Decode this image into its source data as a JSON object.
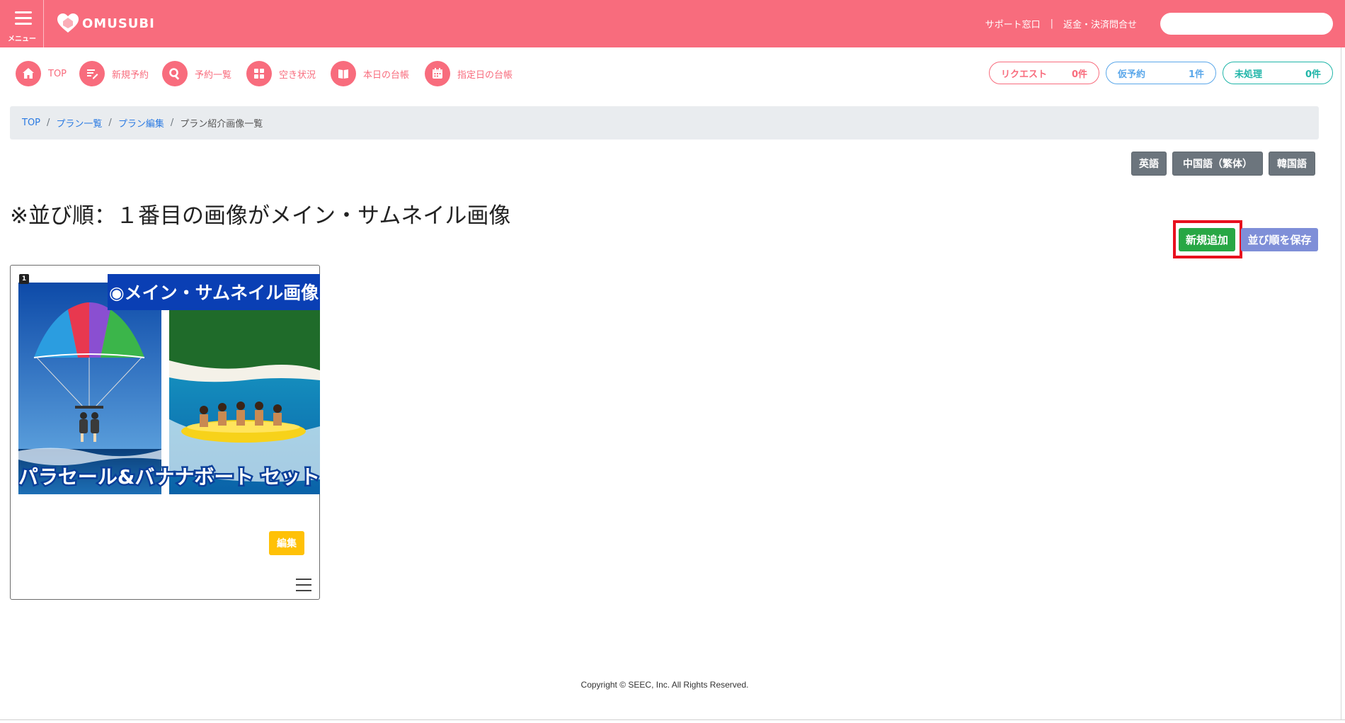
{
  "header": {
    "menu_label": "メニュー",
    "logo_text": "OMUSUBI",
    "links": [
      "サポート窓口",
      "返金・決済問合せ"
    ],
    "link_separator": "|",
    "search_placeholder": ""
  },
  "nav": {
    "items": [
      {
        "label": "TOP",
        "icon": "home-icon"
      },
      {
        "label": "新規予約",
        "icon": "edit-icon"
      },
      {
        "label": "予約一覧",
        "icon": "search-icon"
      },
      {
        "label": "空き状況",
        "icon": "grid-icon"
      },
      {
        "label": "本日の台帳",
        "icon": "book-icon"
      },
      {
        "label": "指定日の台帳",
        "icon": "calendar-icon"
      }
    ],
    "status_pills": [
      {
        "label": "リクエスト",
        "value": "0件",
        "color": "#f86c7d"
      },
      {
        "label": "仮予約",
        "value": "1件",
        "color": "#5aa7ea"
      },
      {
        "label": "未処理",
        "value": "0件",
        "color": "#1fb5a8"
      }
    ]
  },
  "breadcrumb": {
    "items": [
      "TOP",
      "プラン一覧",
      "プラン編集"
    ],
    "current": "プラン紹介画像一覧",
    "separator": "/"
  },
  "language_buttons": [
    "英語",
    "中国語（繁体）",
    "韓国語"
  ],
  "heading": "※並び順：１番目の画像がメイン・サムネイル画像",
  "actions": {
    "add": "新規追加",
    "save_order": "並び順を保存"
  },
  "images": [
    {
      "index": "1",
      "banner_text": "◉メイン・サムネイル画像",
      "caption_text": "パラセール&バナナボート セット",
      "edit_label": "編集"
    }
  ],
  "footer": {
    "copyright": "Copyright © SEEC, Inc. All Rights Reserved."
  },
  "colors": {
    "brand": "#f86c7d",
    "add_button": "#28a745",
    "save_order_button": "#7f8fd8",
    "edit_button": "#ffc107",
    "language_button": "#6c757d",
    "highlight_outline": "#e8101e",
    "banner": "#0a3fb4"
  }
}
